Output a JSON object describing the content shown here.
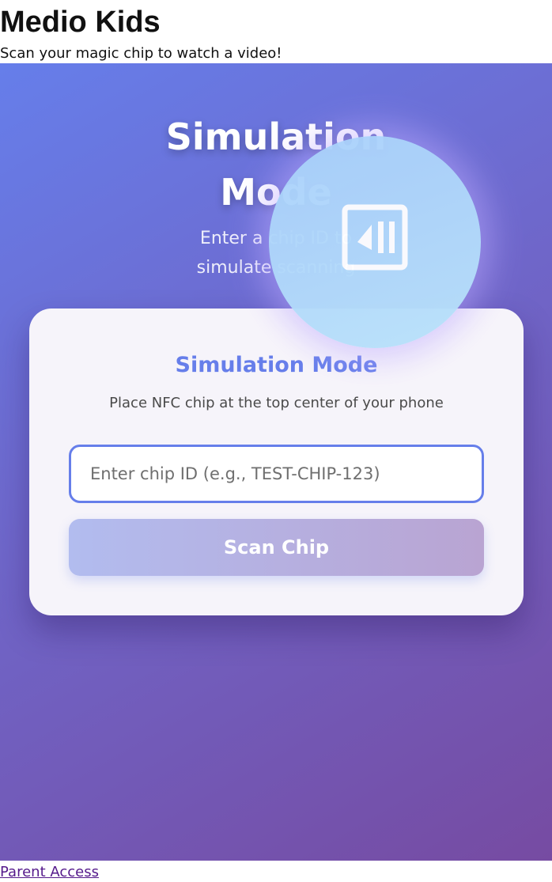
{
  "header": {
    "title": "Medio Kids",
    "subtitle": "Scan your magic chip to watch a video!"
  },
  "hero": {
    "title_line1": "Simulation",
    "title_line2": "Mode",
    "subtitle_line1": "Enter a chip ID to",
    "subtitle_line2": "simulate scanning"
  },
  "nfc_indicator": {
    "icon": "nfc-icon"
  },
  "card": {
    "title": "Simulation Mode",
    "hint": "Place NFC chip at the top center of your phone",
    "input_placeholder": "Enter chip ID (e.g., TEST-CHIP-123)",
    "input_value": "",
    "scan_button_label": "Scan Chip"
  },
  "footer": {
    "parent_access_label": "Parent Access"
  },
  "colors": {
    "gradient_start": "#667eea",
    "gradient_end": "#764ba2",
    "accent": "#667eea",
    "card_background": "#f6f4fa",
    "link": "#551a8b"
  }
}
